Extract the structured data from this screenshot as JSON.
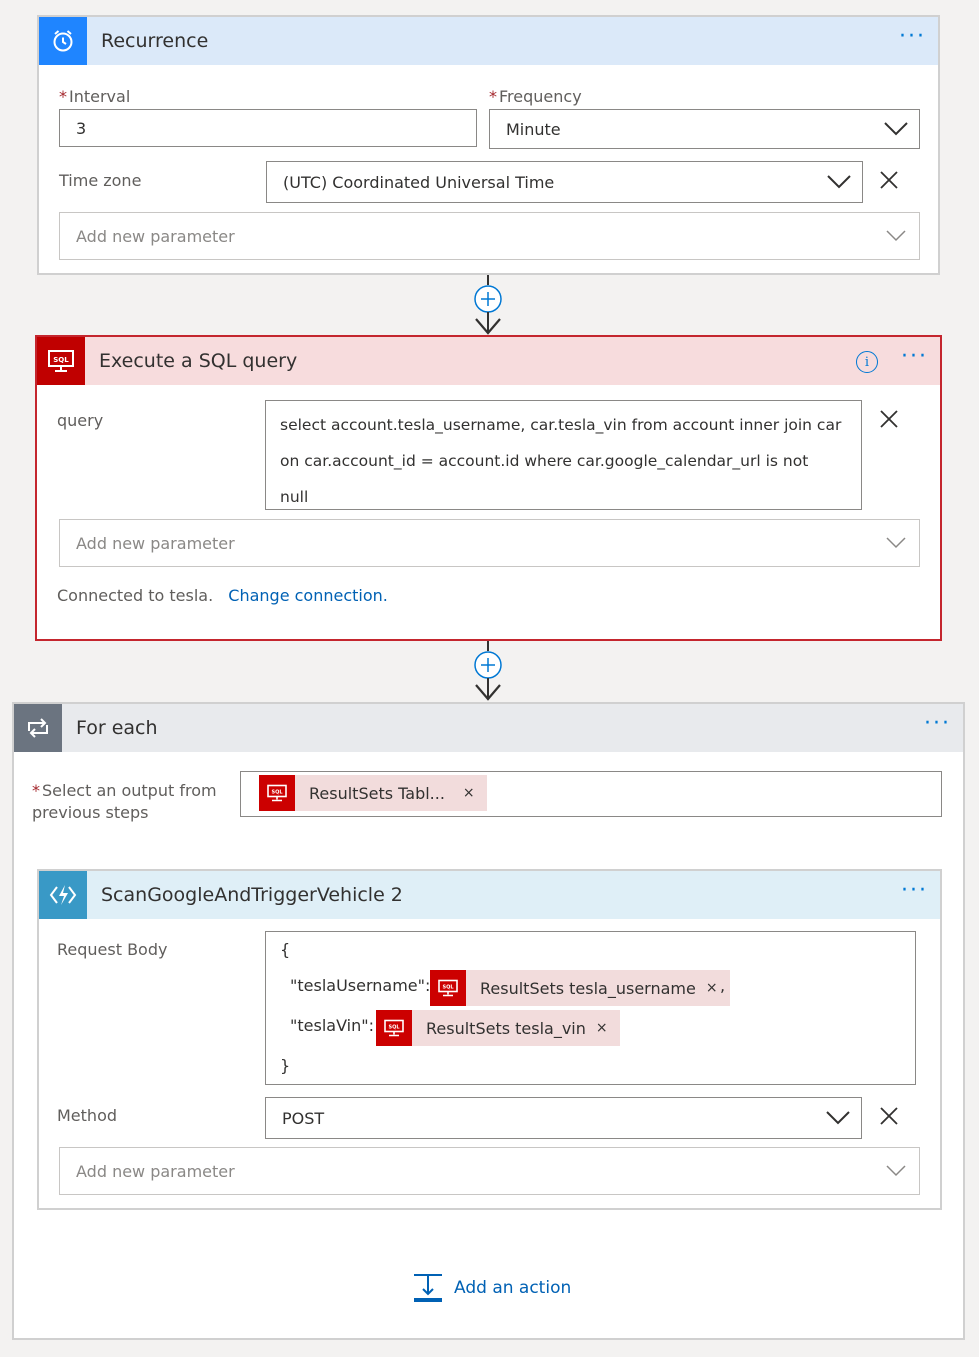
{
  "recurrence": {
    "title": "Recurrence",
    "interval_label": "Interval",
    "interval_value": "3",
    "frequency_label": "Frequency",
    "frequency_value": "Minute",
    "timezone_label": "Time zone",
    "timezone_value": "(UTC) Coordinated Universal Time",
    "add_param": "Add new parameter"
  },
  "sql": {
    "title": "Execute a SQL query",
    "query_label": "query",
    "query_line1": "select account.tesla_username, car.tesla_vin from account inner join car",
    "query_line2": "on car.account_id = account.id  where car.google_calendar_url is not",
    "query_line3": "null",
    "add_param": "Add new parameter",
    "connected_text": "Connected to tesla.",
    "change_connection": "Change connection.",
    "icon_text": "SQL"
  },
  "foreach": {
    "title": "For each",
    "select_label_line1": "Select an output from",
    "select_label_line2": "previous steps",
    "token_text": "ResultSets Tabl...",
    "token_close": "×"
  },
  "scan": {
    "title": "ScanGoogleAndTriggerVehicle 2",
    "body_label": "Request Body",
    "brace_open": "{",
    "brace_close": "}",
    "key_username": "\"teslaUsername\":",
    "token_username": "ResultSets tesla_username",
    "comma": ",",
    "key_vin": "\"teslaVin\":",
    "token_vin": "ResultSets tesla_vin",
    "token_close": "×",
    "method_label": "Method",
    "method_value": "POST",
    "add_param": "Add new parameter"
  },
  "add_action": "Add an action",
  "colors": {
    "blue": "#0078d4",
    "sql_red": "#c00000",
    "foreach_gray": "#6b7480",
    "function_blue": "#3999c6"
  }
}
